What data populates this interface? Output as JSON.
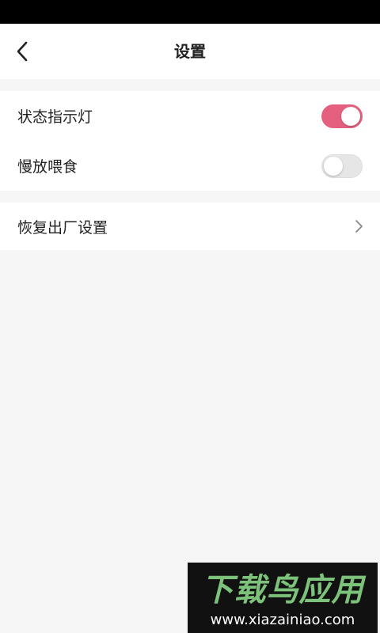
{
  "header": {
    "title": "设置",
    "back_icon": "chevron-left-icon"
  },
  "settings": {
    "status_light": {
      "label": "状态指示灯",
      "enabled": true
    },
    "slow_feed": {
      "label": "慢放喂食",
      "enabled": false
    },
    "factory_reset": {
      "label": "恢复出厂设置",
      "icon": "chevron-right-icon"
    }
  },
  "colors": {
    "accent": "#e5607f",
    "background": "#f6f6f6",
    "toggle_off": "#e6e6e6"
  },
  "watermark": {
    "brand": "下载鸟应用",
    "url": "www.xiazainiao.com"
  }
}
